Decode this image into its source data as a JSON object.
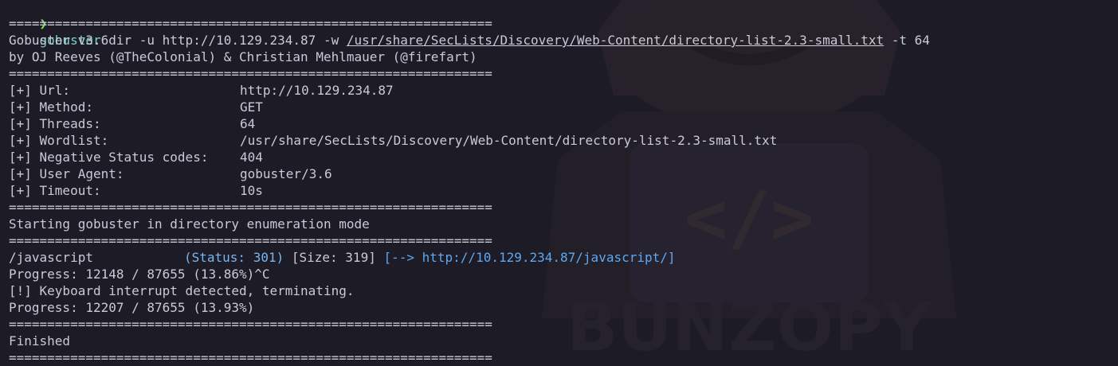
{
  "colors": {
    "background": "#1c1b26",
    "text": "#c8cbd6",
    "prompt": "#7ed957",
    "command": "#79d0c8",
    "status": "#79b6f2",
    "redirect": "#5fa8f0"
  },
  "command": {
    "prompt_glyph": "❯",
    "program": "gobuster",
    "args_before_path": " dir -u http://10.129.234.87 -w ",
    "wordlist_path": "/usr/share/SecLists/Discovery/Web-Content/directory-list-2.3-small.txt",
    "args_after_path": " -t 64"
  },
  "separator": "===============================================================",
  "banner": {
    "version": "Gobuster v3.6",
    "authors": "by OJ Reeves (@TheColonial) & Christian Mehlmauer (@firefart)"
  },
  "config": [
    {
      "key": "[+] Url:",
      "value": "http://10.129.234.87"
    },
    {
      "key": "[+] Method:",
      "value": "GET"
    },
    {
      "key": "[+] Threads:",
      "value": "64"
    },
    {
      "key": "[+] Wordlist:",
      "value": "/usr/share/SecLists/Discovery/Web-Content/directory-list-2.3-small.txt"
    },
    {
      "key": "[+] Negative Status codes:",
      "value": "404"
    },
    {
      "key": "[+] User Agent:",
      "value": "gobuster/3.6"
    },
    {
      "key": "[+] Timeout:",
      "value": "10s"
    }
  ],
  "mode_message": "Starting gobuster in directory enumeration mode",
  "results": [
    {
      "path": "/javascript",
      "status": "(Status: 301)",
      "size": " [Size: 319] ",
      "redirect": "[--> http://10.129.234.87/javascript/]"
    }
  ],
  "progress_lines": [
    "Progress: 12148 / 87655 (13.86%)^C",
    "[!] Keyboard interrupt detected, terminating.",
    "Progress: 12207 / 87655 (13.93%)"
  ],
  "finished": "Finished",
  "watermark": {
    "text": "BUNZOPY",
    "icon": "cat-coder-logo-icon",
    "code_glyph": "</>"
  }
}
